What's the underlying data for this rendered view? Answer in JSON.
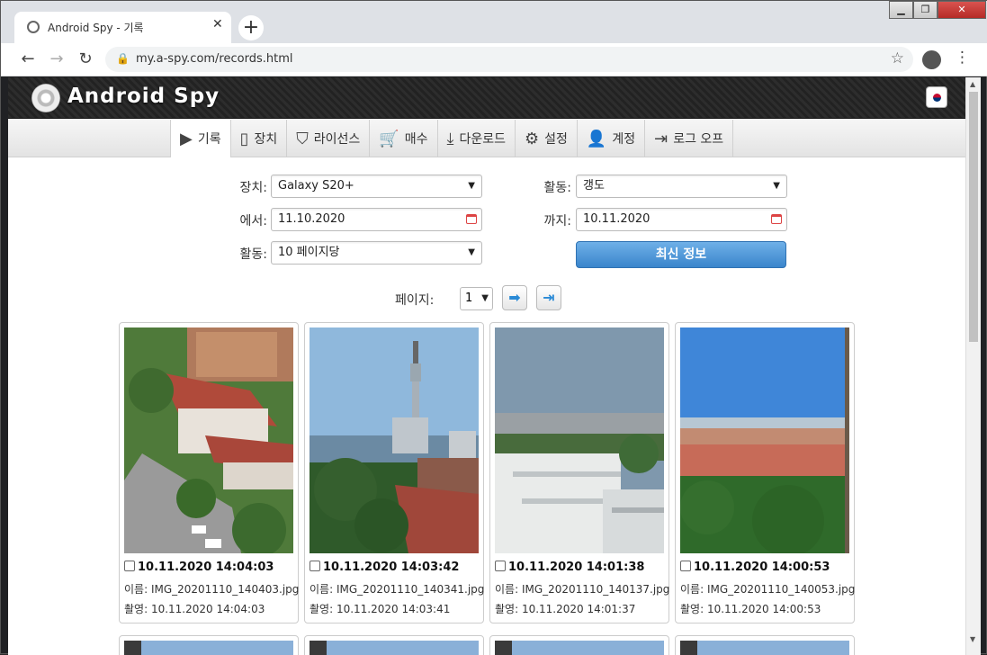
{
  "browser": {
    "tab_title": "Android Spy - 기록",
    "tab_close": "✕",
    "new_tab": "+",
    "url": "my.a-spy.com/records.html",
    "win_min": "▁",
    "win_max": "❐",
    "win_close": "✕"
  },
  "site": {
    "logo_text": "Android Spy",
    "menu": [
      {
        "icon": "▶",
        "label": "기록"
      },
      {
        "icon": "▯",
        "label": "장치"
      },
      {
        "icon": "⛉",
        "label": "라이선스"
      },
      {
        "icon": "🛒",
        "label": "매수"
      },
      {
        "icon": "⤓",
        "label": "다운로드"
      },
      {
        "icon": "⚙",
        "label": "설정"
      },
      {
        "icon": "👤",
        "label": "계정"
      },
      {
        "icon": "⇥",
        "label": "로그 오프"
      }
    ]
  },
  "filters": {
    "device_label": "장치:",
    "device_value": "Galaxy S20+",
    "activity_label": "활동:",
    "activity_value": "갱도",
    "from_label": "에서:",
    "from_value": "11.10.2020",
    "to_label": "까지:",
    "to_value": "10.11.2020",
    "perpage_label": "활동:",
    "perpage_value": "10 페이지당",
    "refresh_button": "최신 정보"
  },
  "pager": {
    "label": "페이지:",
    "value": "1",
    "next": "➡",
    "last": "⇥"
  },
  "records": [
    {
      "time": "10.11.2020 14:04:03",
      "name": "이름: IMG_20201110_140403.jpg",
      "shot": "촬영: 10.11.2020 14:04:03"
    },
    {
      "time": "10.11.2020 14:03:42",
      "name": "이름: IMG_20201110_140341.jpg",
      "shot": "촬영: 10.11.2020 14:03:41"
    },
    {
      "time": "10.11.2020 14:01:38",
      "name": "이름: IMG_20201110_140137.jpg",
      "shot": "촬영: 10.11.2020 14:01:37"
    },
    {
      "time": "10.11.2020 14:00:53",
      "name": "이름: IMG_20201110_140053.jpg",
      "shot": "촬영: 10.11.2020 14:00:53"
    }
  ]
}
